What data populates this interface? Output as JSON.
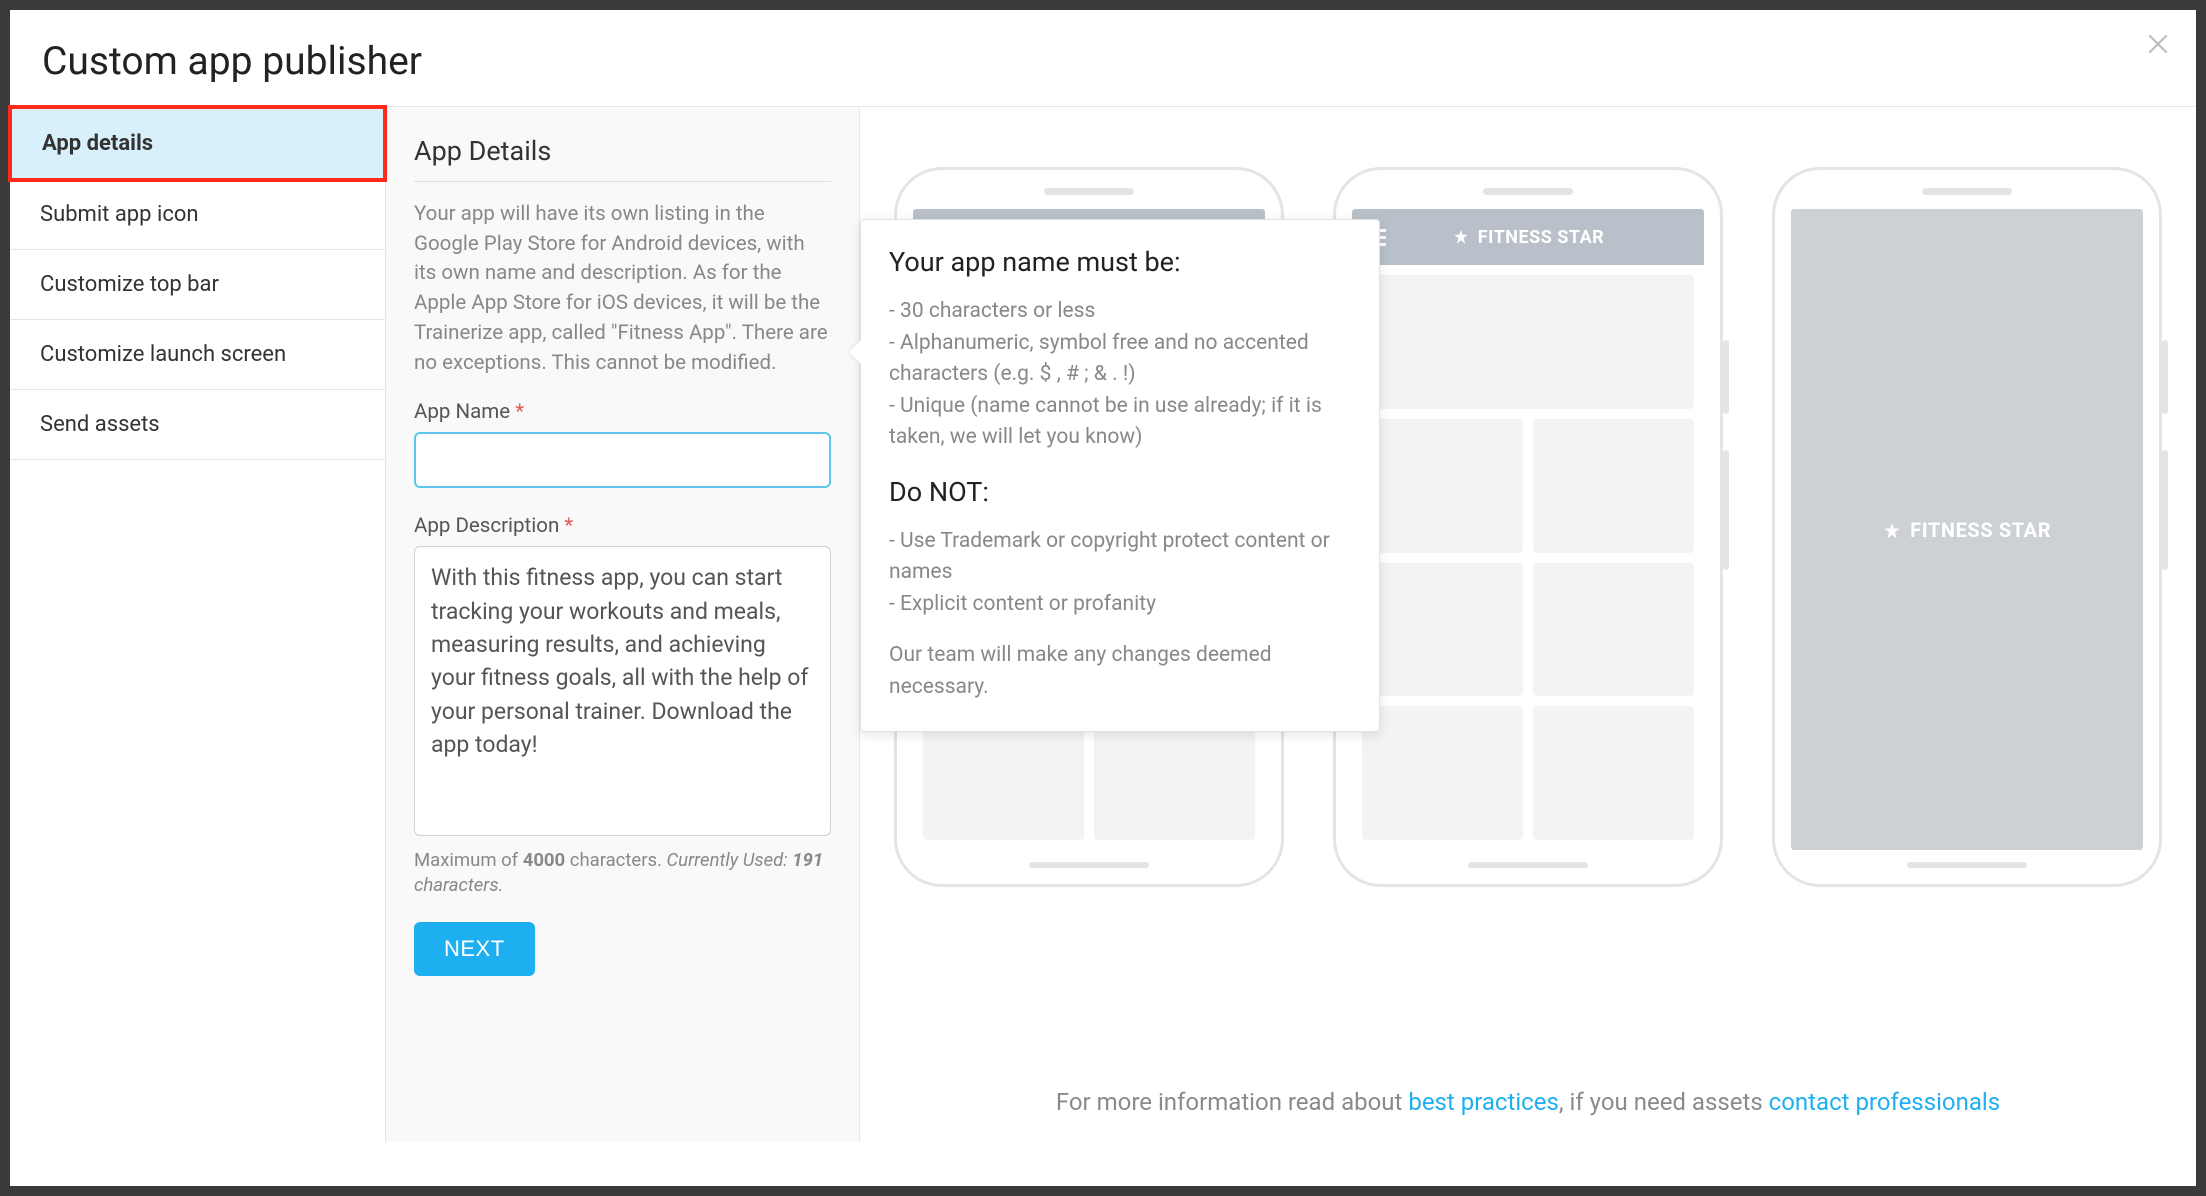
{
  "header": {
    "title": "Custom app publisher"
  },
  "sidebar": {
    "items": [
      {
        "label": "App details",
        "active": true
      },
      {
        "label": "Submit app icon"
      },
      {
        "label": "Customize top bar"
      },
      {
        "label": "Customize launch screen"
      },
      {
        "label": "Send assets"
      }
    ]
  },
  "form": {
    "heading": "App Details",
    "intro": "Your app will have its own listing in the Google Play Store for Android devices, with its own name and description. As for the Apple App Store for iOS devices, it will be the Trainerize app, called \"Fitness App\". There are no exceptions. This cannot be modified.",
    "nameLabel": "App Name",
    "nameValue": "",
    "descLabel": "App Description",
    "descValue": "With this fitness app, you can start tracking your workouts and meals, measuring results, and achieving your fitness goals, all with the help of your personal trainer. Download the app today!",
    "charNote": {
      "prefix": "Maximum of ",
      "max": "4000",
      "mid": " characters. ",
      "usedLabel": "Currently Used: ",
      "used": "191",
      "suffix": " characters."
    },
    "nextLabel": "NEXT"
  },
  "popover": {
    "title1": "Your app name must be:",
    "rules": [
      "- 30 characters or less",
      "- Alphanumeric, symbol free and no accented characters (e.g. $ , # ; & . !)",
      "- Unique (name cannot be in use already; if it is taken, we will let you know)"
    ],
    "title2": "Do NOT:",
    "donts": [
      "- Use Trademark or copyright protect content or names",
      "- Explicit content or profanity"
    ],
    "footnote": "Our team will make any changes deemed necessary."
  },
  "preview": {
    "brand": "FITNESS STAR"
  },
  "footerInfo": {
    "t1": "For more information read about ",
    "link1": "best practices",
    "t2": ", if you need assets ",
    "link2": "contact professionals"
  }
}
